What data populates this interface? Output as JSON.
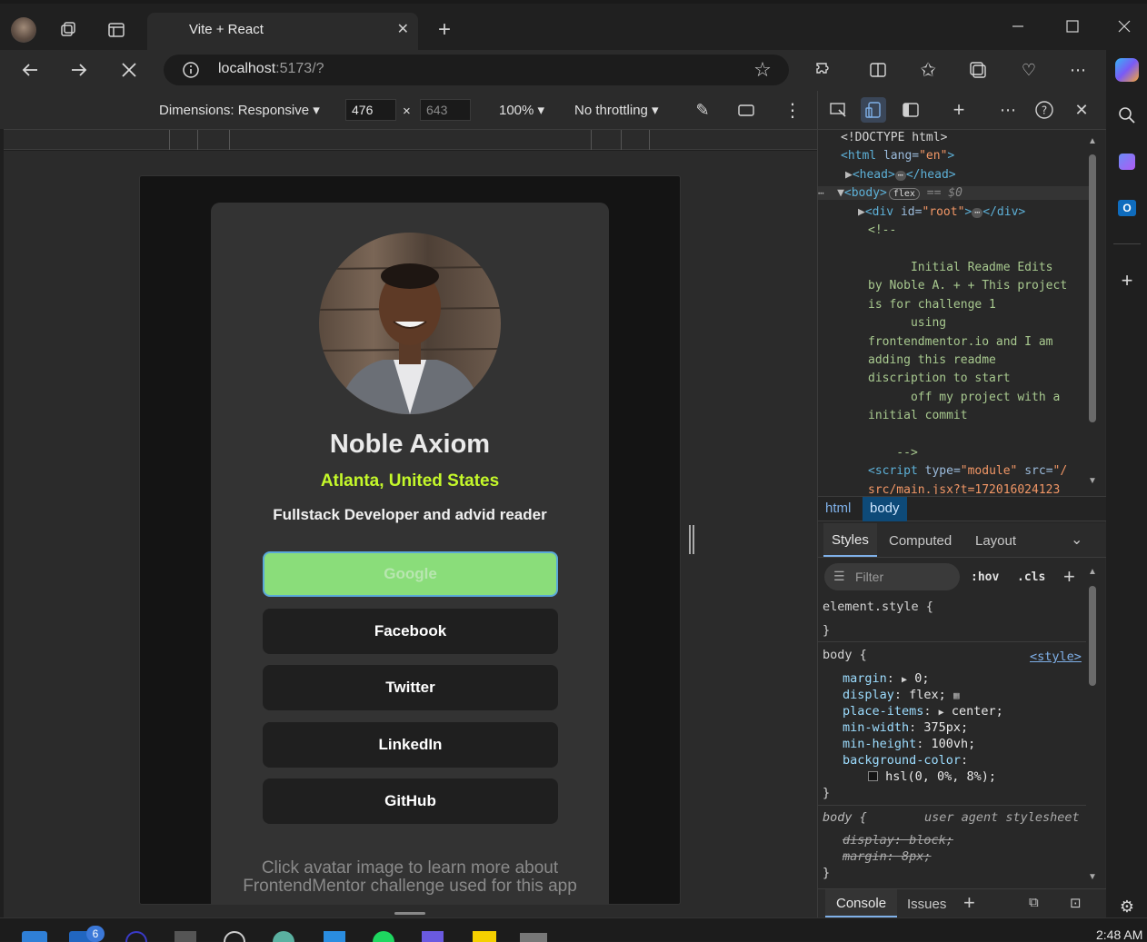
{
  "browser": {
    "tab_title": "Vite + React",
    "url_host": "localhost",
    "url_rest": ":5173/?"
  },
  "device_toolbar": {
    "dimensions_label": "Dimensions: Responsive",
    "width": "476",
    "height_placeholder": "643",
    "zoom": "100%",
    "throttling": "No throttling"
  },
  "profile": {
    "name": "Noble Axiom",
    "location": "Atlanta, United States",
    "bio": "Fullstack Developer and advid reader",
    "links": [
      "Google",
      "Facebook",
      "Twitter",
      "LinkedIn",
      "GitHub"
    ],
    "footer_line1": "Click avatar image to learn more about",
    "footer_line2": "FrontendMentor challenge used for this app"
  },
  "devtools": {
    "dom": {
      "doctype": "<!DOCTYPE html>",
      "html_open_tag": "html",
      "html_attr": "lang",
      "html_attr_val": "\"en\"",
      "head_tag": "<head>",
      "head_close": "</head>",
      "body_tag": "<body>",
      "flex_badge": "flex",
      "eq_dollar": "== $0",
      "div_tag": "<div",
      "div_attr": "id",
      "div_attr_val": "\"root\"",
      "div_close_start": ">",
      "div_close": "</div>",
      "comment_open": "<!--",
      "comment_lines": [
        "      Initial Readme Edits",
        "by Noble A. + + This project",
        "is for challenge 1",
        "      using",
        "frontendmentor.io and I am",
        "adding this readme",
        "discription to start",
        "      off my project with a",
        "initial commit"
      ],
      "comment_close": "    -->",
      "script_tag": "<script",
      "script_attr1": "type",
      "script_val1": "\"module\"",
      "script_attr2": "src",
      "script_val2": "\"/",
      "script_val2b": "src/main.jsx?t=172016024123"
    },
    "breadcrumb": [
      "html",
      "body"
    ],
    "style_tabs": [
      "Styles",
      "Computed",
      "Layout"
    ],
    "filter_placeholder": "Filter",
    "hov": ":hov",
    "cls": ".cls",
    "element_style": "element.style {",
    "close_brace": "}",
    "rule1_selector": "body {",
    "rule1_source": "<style>",
    "rule1_props": [
      {
        "name": "margin",
        "value": "0;",
        "arrow": true
      },
      {
        "name": "display",
        "value": "flex;"
      },
      {
        "name": "place-items",
        "value": "center;",
        "arrow": true
      },
      {
        "name": "min-width",
        "value": "375px;"
      },
      {
        "name": "min-height",
        "value": "100vh;"
      },
      {
        "name": "background-color",
        "value": ""
      }
    ],
    "bg_value": "hsl(0, 0%, 8%);",
    "rule2_selector": "body {",
    "rule2_source": "user agent stylesheet",
    "rule2_props": [
      "display: block;",
      "margin: 8px;"
    ],
    "console_tabs": [
      "Console",
      "Issues"
    ]
  },
  "taskbar": {
    "time": "2:48 AM",
    "badge": "6"
  },
  "colors": {
    "accent_green": "#c4f82a",
    "button_active": "#8add7a",
    "card": "#333333"
  }
}
